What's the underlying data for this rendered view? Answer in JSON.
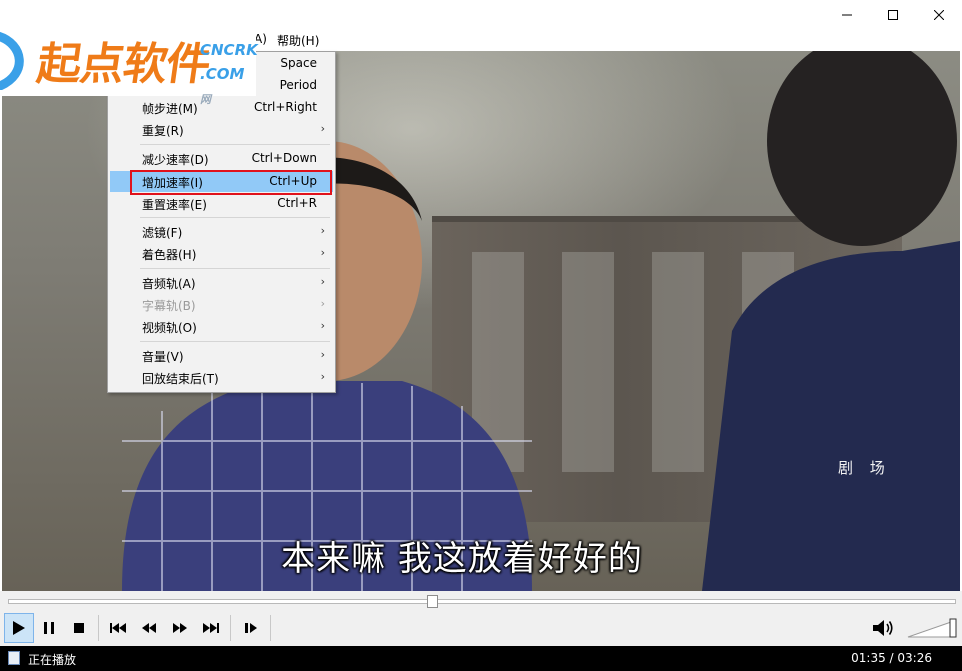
{
  "titlebar": {
    "minimize": "—",
    "maximize": "☐",
    "close": "✕"
  },
  "logo": {
    "name": "起点软件",
    "badge_line1": "CNCRK",
    "badge_line2": ".COM",
    "badge_suffix": "网"
  },
  "menubar": {
    "partial_item": "A)",
    "help": "帮助(H)"
  },
  "context_menu": {
    "items": [
      {
        "label": "",
        "shortcut": "Space"
      },
      {
        "label": "",
        "shortcut": "Period"
      },
      {
        "label": "帧步进(M)",
        "shortcut": "Ctrl+Right"
      },
      {
        "label": "重复(R)",
        "arrow": "›"
      },
      {
        "label": "减少速率(D)",
        "shortcut": "Ctrl+Down"
      },
      {
        "label": "增加速率(I)",
        "shortcut": "Ctrl+Up"
      },
      {
        "label": "重置速率(E)",
        "shortcut": "Ctrl+R"
      },
      {
        "label": "滤镜(F)",
        "arrow": "›"
      },
      {
        "label": "着色器(H)",
        "arrow": "›"
      },
      {
        "label": "音频轨(A)",
        "arrow": "›"
      },
      {
        "label": "字幕轨(B)",
        "arrow": "›"
      },
      {
        "label": "视频轨(O)",
        "arrow": "›"
      },
      {
        "label": "音量(V)",
        "arrow": "›"
      },
      {
        "label": "回放结束后(T)",
        "arrow": "›"
      }
    ]
  },
  "video": {
    "subtitle": "本来嘛 我这放着好好的",
    "watermark": "剧 场"
  },
  "seek": {
    "progress": 0.4476
  },
  "status": {
    "text": "正在播放",
    "time": "01:35 / 03:26"
  },
  "colors": {
    "accent": "#e0121c",
    "highlight": "#91c9f7",
    "logo_orange": "#ef7b18",
    "logo_blue": "#3aa0e8"
  }
}
